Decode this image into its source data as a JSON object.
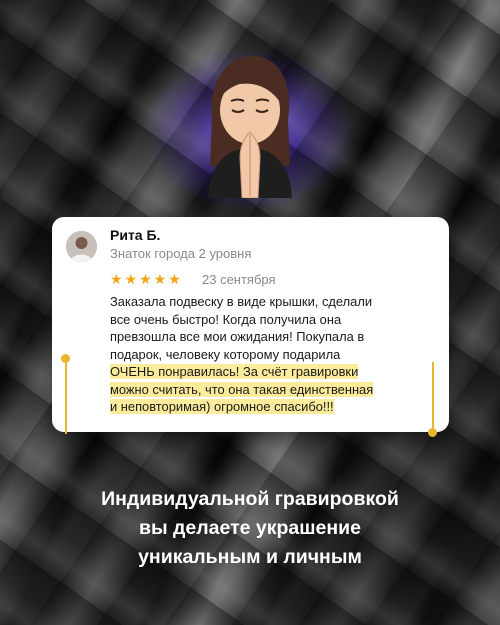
{
  "review": {
    "author_name": "Рита Б.",
    "author_status": "Знаток города 2 уровня",
    "rating_stars": 5,
    "stars_text": "★★★★★",
    "date": "23 сентября",
    "lines": [
      "Заказала подвеску в виде крышки, сделали",
      "все очень быстро! Когда получила она",
      "превзошла все мои ожидания! Покупала в",
      "подарок, человеку которому подарила",
      "ОЧЕНЬ понравилась! За счёт гравировки",
      "можно считать, что она такая единственная",
      "и неповторимая) огромное спасибо!!!"
    ],
    "highlight_color": "#fbec9c",
    "marker_color": "#e8b52f"
  },
  "caption": {
    "line1": "Индивидуальной гравировкой",
    "line2": "вы делаете украшение",
    "line3": "уникальным и личным"
  },
  "colors": {
    "star": "#f2a516",
    "glow": "#623ceb"
  },
  "icons": {
    "hero": "praying-memoji-icon",
    "user": "user-avatar"
  }
}
